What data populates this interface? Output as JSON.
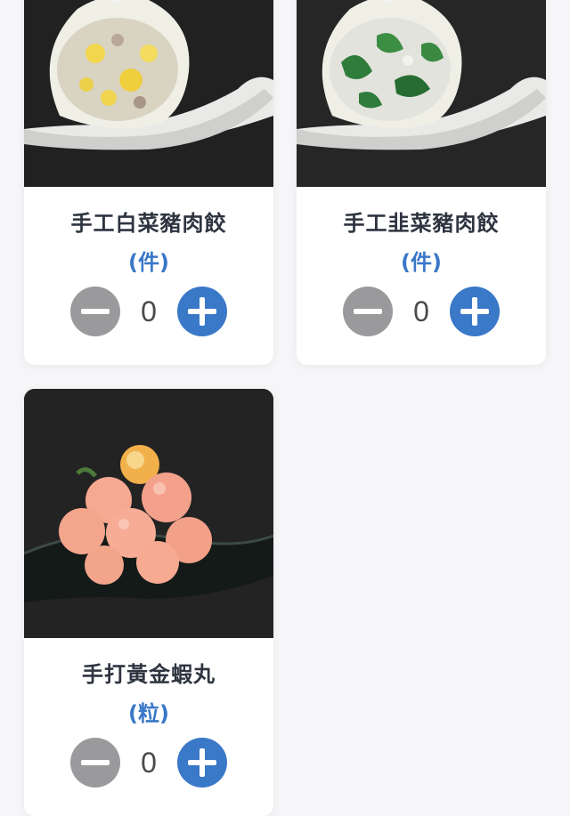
{
  "colors": {
    "page_background": "#f6f6f8",
    "card_background": "#ffffff",
    "name_text": "#2e3440",
    "unit_text": "#3a78c8",
    "minus_button": "#9a9a9c",
    "plus_button": "#3a78c8",
    "quantity_text": "#4a4a4a"
  },
  "products": [
    {
      "name": "手工白菜豬肉餃",
      "unit": "(件)",
      "quantity": "0",
      "image": "dumpling-cabbage-pork-image",
      "minus_icon": "minus-circle-icon",
      "plus_icon": "plus-circle-icon"
    },
    {
      "name": "手工韭菜豬肉餃",
      "unit": "(件)",
      "quantity": "0",
      "image": "dumpling-chive-pork-image",
      "minus_icon": "minus-circle-icon",
      "plus_icon": "plus-circle-icon"
    },
    {
      "name": "手打黃金蝦丸",
      "unit": "(粒)",
      "quantity": "0",
      "image": "golden-shrimp-balls-image",
      "minus_icon": "minus-circle-icon",
      "plus_icon": "plus-circle-icon"
    }
  ]
}
